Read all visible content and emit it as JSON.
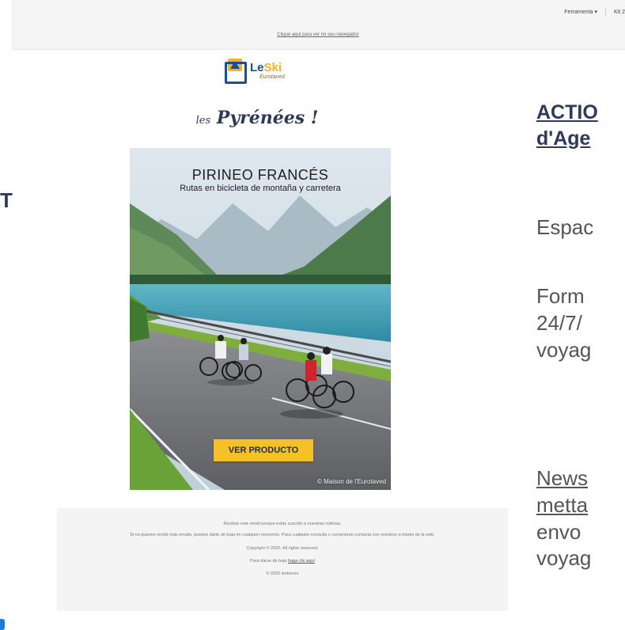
{
  "topbar": {
    "menus": [
      {
        "label": "Ferramenta",
        "has_caret": true
      },
      {
        "label": "Kit 2"
      }
    ],
    "browser_note": "Clique aqui para ver no seu navegador"
  },
  "left_fragment": {
    "text": "T"
  },
  "email": {
    "logo": {
      "le": "Le",
      "ski": "Ski",
      "sub": "Eurotaved"
    },
    "tagline_prefix": "les",
    "tagline_main": "Pyrénées !",
    "hero": {
      "title": "PIRINEO FRANCÉS",
      "subtitle": "Rutas en bicicleta de montaña y carretera",
      "cta_label": "VER PRODUCTO",
      "credit": "© Maison de l'Eurotaved"
    },
    "footer": {
      "line1": "Recibes este email porque estás suscrito a nuestras noticias.",
      "line2": "Si no quieres recibir más emails, puedes darte de baja en cualquier momento. Para cualquier consulta o comentario contacta con nosotros a través de la web.",
      "line3": "Copyright © 2020. All rights reserved.",
      "line4_prefix": "Para darse de baja",
      "line4_link": "haga clic aquí",
      "line5": "© 2020 leskieuro"
    }
  },
  "right_col": {
    "heading_line1": "ACTIO",
    "heading_line2": "d'Age",
    "espace": "Espac",
    "form_lines": [
      "Form",
      "24/7/",
      "voyag"
    ],
    "news_link_lines": [
      "News",
      "metta"
    ],
    "news_lines": [
      "envo",
      "voyag"
    ]
  },
  "colors": {
    "brand_blue": "#1c4f8f",
    "brand_yellow": "#f4b227",
    "heading_navy": "#2f3a5b",
    "cta_yellow": "#f5c028"
  }
}
